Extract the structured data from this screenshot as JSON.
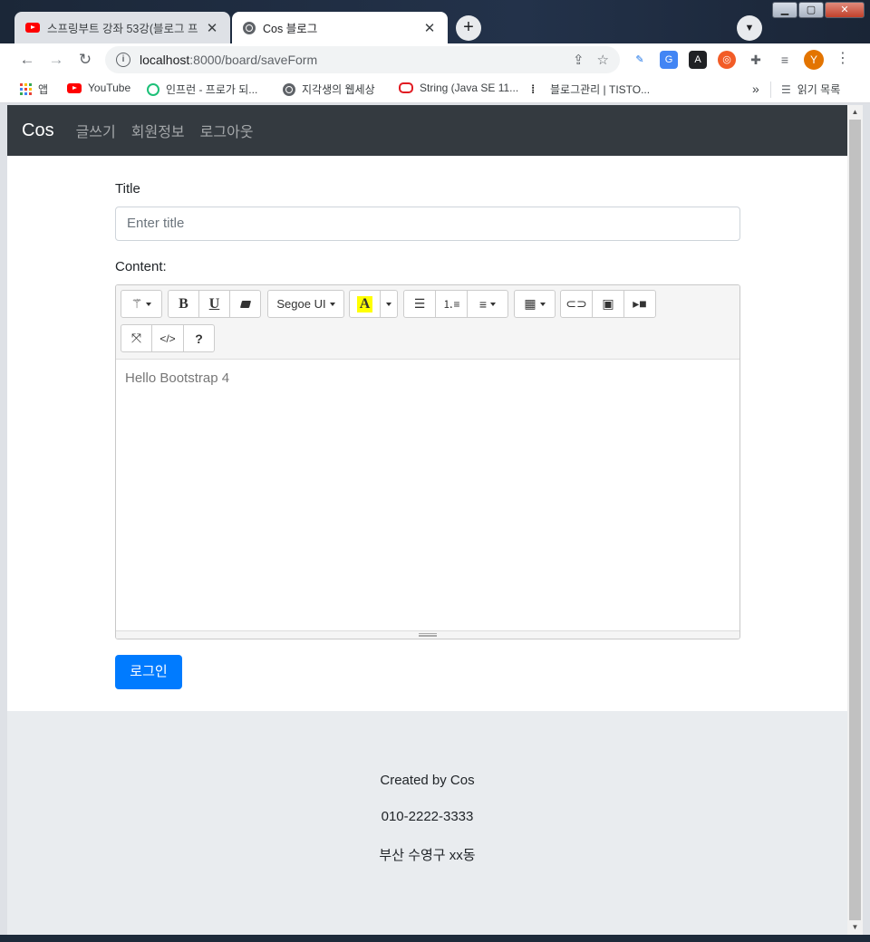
{
  "browser": {
    "tabs": [
      {
        "title": "스프링부트 강좌 53강(블로그 프",
        "active": false,
        "favicon": "youtube-icon"
      },
      {
        "title": "Cos 블로그",
        "active": true,
        "favicon": "globe-icon"
      }
    ],
    "new_tab": "+",
    "address": {
      "host": "localhost",
      "path": ":8000/board/saveForm"
    },
    "avatar_letter": "Y",
    "bookmarks": [
      {
        "label": "앱",
        "icon": "apps-grid-icon"
      },
      {
        "label": "YouTube",
        "icon": "youtube-icon"
      },
      {
        "label": "인프런 - 프로가 되...",
        "icon": "inflearn-icon"
      },
      {
        "label": "지각생의 웹세상",
        "icon": "globe-icon"
      },
      {
        "label": "String (Java SE 11...",
        "icon": "oracle-icon"
      },
      {
        "label": "블로그관리 | TISTO...",
        "icon": "tistory-icon"
      }
    ],
    "bookmarks_more": "»",
    "reading_list": "읽기 목록"
  },
  "navbar": {
    "brand": "Cos",
    "links": [
      "글쓰기",
      "회원정보",
      "로그아웃"
    ]
  },
  "form": {
    "title_label": "Title",
    "title_placeholder": "Enter title",
    "content_label": "Content:",
    "editor": {
      "font_name": "Segoe UI",
      "body_text": "Hello Bootstrap 4"
    },
    "submit_label": "로그인"
  },
  "footer": {
    "line1": "Created by Cos",
    "line2": "010-2222-3333",
    "line3": "부산 수영구 xx동"
  },
  "colors": {
    "navbar_bg": "#343a40",
    "primary": "#007bff",
    "footer_bg": "#e9ecef"
  }
}
